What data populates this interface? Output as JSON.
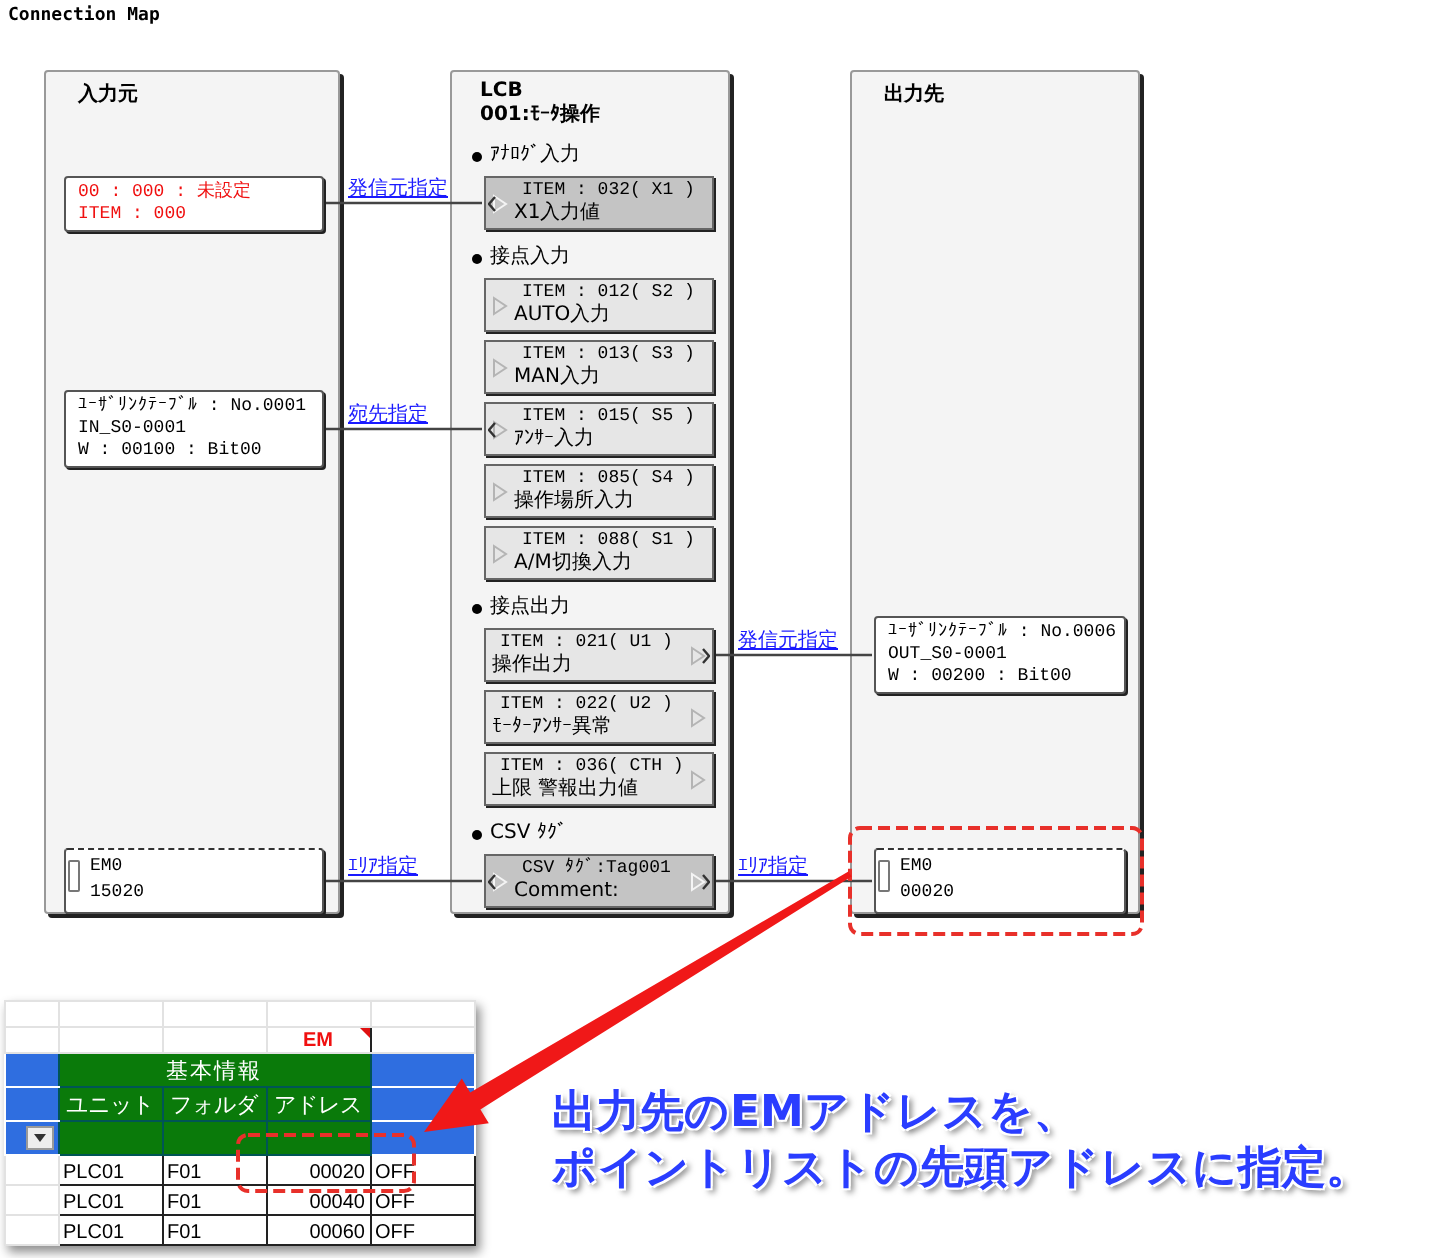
{
  "title": "Connection Map",
  "sources": {
    "title": "入力元",
    "nodes": [
      {
        "kind": "unset",
        "lines": [
          "00 : 000  : 未設定",
          "ITEM  : 000"
        ],
        "link_label": "発信元指定"
      },
      {
        "kind": "link",
        "lines": [
          "ﾕｰｻﾞﾘﾝｸﾃｰﾌﾞﾙ : No.0001",
          "IN_S0-0001",
          "W : 00100 : Bit00"
        ],
        "link_label": "宛先指定"
      },
      {
        "kind": "em",
        "lines": [
          "EM0",
          "15020"
        ],
        "link_label": "ｴﾘｱ指定"
      }
    ]
  },
  "block": {
    "title_lines": [
      "LCB",
      "001:ﾓｰﾀ操作"
    ],
    "sections": [
      {
        "title": "ｱﾅﾛｸﾞ入力",
        "kind": "input",
        "items": [
          {
            "lines": [
              "ITEM : 032( X1 )",
              "X1入力値"
            ],
            "shaded": true,
            "linked_in": true,
            "linked_out": false
          }
        ]
      },
      {
        "title": "接点入力",
        "kind": "input",
        "items": [
          {
            "lines": [
              "ITEM : 012( S2 )",
              "AUTO入力"
            ],
            "shaded": false,
            "linked_in": false,
            "linked_out": false
          },
          {
            "lines": [
              "ITEM : 013( S3 )",
              "MAN入力"
            ],
            "shaded": false,
            "linked_in": false,
            "linked_out": false
          },
          {
            "lines": [
              "ITEM : 015( S5 )",
              "ｱﾝｻｰ入力"
            ],
            "shaded": false,
            "linked_in": true,
            "linked_out": false
          },
          {
            "lines": [
              "ITEM : 085( S4 )",
              "操作場所入力"
            ],
            "shaded": false,
            "linked_in": false,
            "linked_out": false
          },
          {
            "lines": [
              "ITEM : 088( S1 )",
              "A/M切換入力"
            ],
            "shaded": false,
            "linked_in": false,
            "linked_out": false
          }
        ]
      },
      {
        "title": "接点出力",
        "kind": "output",
        "items": [
          {
            "lines": [
              "ITEM : 021( U1 )",
              "操作出力"
            ],
            "shaded": false,
            "linked_in": false,
            "linked_out": true
          },
          {
            "lines": [
              "ITEM : 022( U2 )",
              "ﾓｰﾀｰｱﾝｻｰ異常"
            ],
            "shaded": false,
            "linked_in": false,
            "linked_out": false
          },
          {
            "lines": [
              "ITEM : 036( CTH )",
              "上限 警報出力値"
            ],
            "shaded": false,
            "linked_in": false,
            "linked_out": false
          }
        ]
      },
      {
        "title": "CSV ﾀｸﾞ",
        "kind": "csv",
        "items": [
          {
            "lines": [
              "CSV ﾀｸﾞ:Tag001",
              "Comment:"
            ],
            "shaded": true,
            "linked_in": true,
            "linked_out": true
          }
        ]
      }
    ]
  },
  "destinations": {
    "title": "出力先",
    "nodes": [
      {
        "kind": "link",
        "lines": [
          "ﾕｰｻﾞﾘﾝｸﾃｰﾌﾞﾙ : No.0006",
          "OUT_S0-0001",
          "W : 00200 : Bit00"
        ],
        "link_label": "発信元指定"
      },
      {
        "kind": "em",
        "lines": [
          "EM0",
          "00020"
        ],
        "link_label": "ｴﾘｱ指定"
      }
    ]
  },
  "sheet": {
    "em_label": "EM",
    "group_header": "基本情報",
    "columns": [
      "ユニット",
      "フォルダ",
      "アドレス"
    ],
    "rows": [
      [
        "PLC01",
        "F01",
        "00020",
        "OFF"
      ],
      [
        "PLC01",
        "F01",
        "00040",
        "OFF"
      ],
      [
        "PLC01",
        "F01",
        "00060",
        "OFF"
      ]
    ]
  },
  "callout": [
    "出力先のEMアドレスを、",
    "ポイントリストの先頭アドレスに指定。"
  ]
}
